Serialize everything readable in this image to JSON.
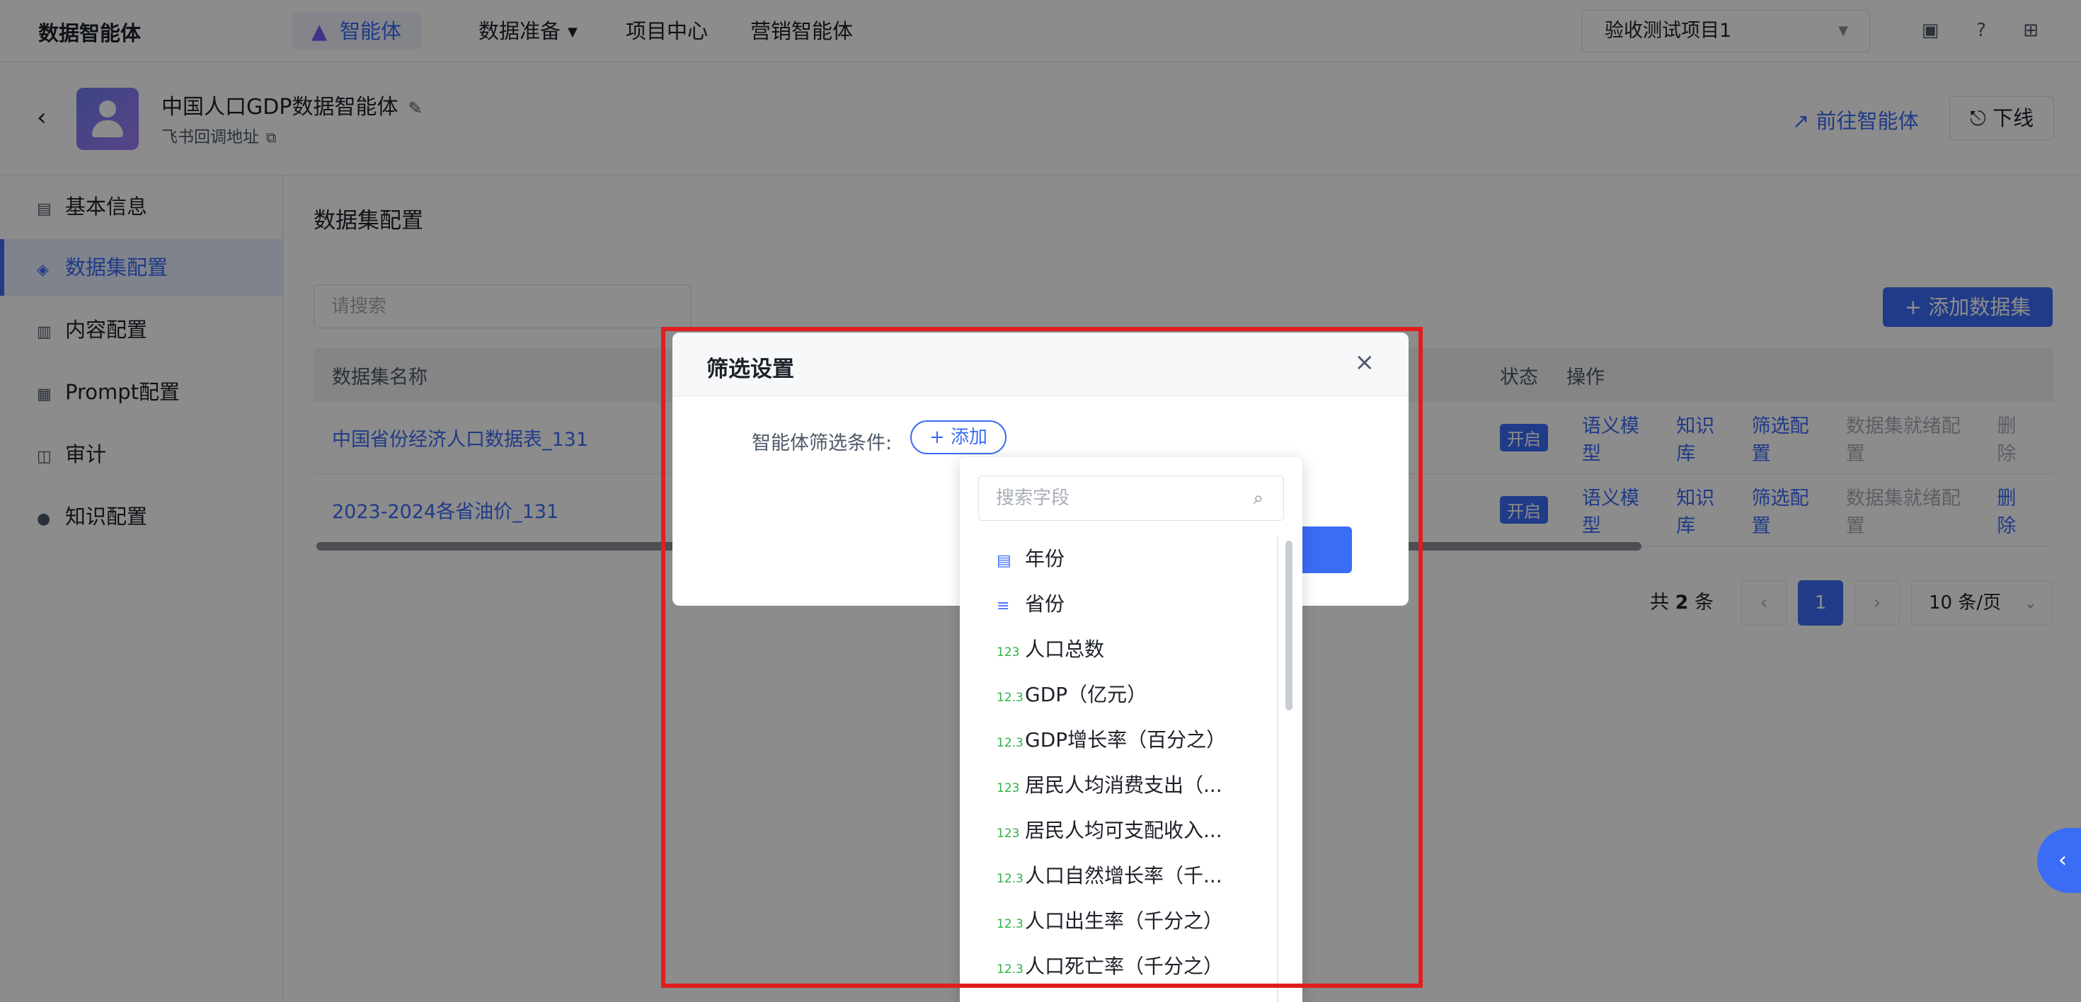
{
  "topbar": {
    "brand": "数据智能体",
    "nav": [
      "智能体",
      "数据准备",
      "项目中心",
      "营销智能体"
    ],
    "project": "验收测试项目1"
  },
  "agent": {
    "name": "中国人口GDP数据智能体",
    "subtitle": "飞书回调地址",
    "goto": "前往智能体",
    "offline": "下线"
  },
  "sidebar": {
    "items": [
      {
        "label": "基本信息",
        "icon": "info-icon"
      },
      {
        "label": "数据集配置",
        "icon": "layers-icon"
      },
      {
        "label": "内容配置",
        "icon": "content-icon"
      },
      {
        "label": "Prompt配置",
        "icon": "prompt-icon"
      },
      {
        "label": "审计",
        "icon": "audit-icon"
      },
      {
        "label": "知识配置",
        "icon": "bulb-icon"
      }
    ]
  },
  "main": {
    "title": "数据集配置",
    "search_placeholder": "请搜索",
    "add_dataset": "添加数据集",
    "columns": {
      "name": "数据集名称",
      "status": "状态",
      "ops": "操作"
    },
    "rows": [
      {
        "name": "中国省份经济人口数据表_131",
        "status": "开启",
        "ops": [
          "语义模型",
          "知识库",
          "筛选配置",
          "数据集就绪配置",
          "删除"
        ]
      },
      {
        "name": "2023-2024各省油价_131",
        "status": "开启",
        "ops": [
          "语义模型",
          "知识库",
          "筛选配置",
          "数据集就绪配置",
          "删除"
        ]
      }
    ],
    "pager": {
      "total_prefix": "共",
      "total": "2",
      "total_suffix": "条",
      "current": "1",
      "page_size": "10 条/页"
    }
  },
  "modal": {
    "title": "筛选设置",
    "condition_label": "智能体筛选条件:",
    "add_button": "+ 添加"
  },
  "dropdown": {
    "search_placeholder": "搜索字段",
    "fields": [
      {
        "type": "date",
        "label": "年份"
      },
      {
        "type": "text",
        "label": "省份"
      },
      {
        "type": "int",
        "label": "人口总数"
      },
      {
        "type": "float",
        "label": "GDP（亿元）"
      },
      {
        "type": "float",
        "label": "GDP增长率（百分之）"
      },
      {
        "type": "int",
        "label": "居民人均消费支出（..."
      },
      {
        "type": "int",
        "label": "居民人均可支配收入..."
      },
      {
        "type": "float",
        "label": "人口自然增长率（千..."
      },
      {
        "type": "float",
        "label": "人口出生率（千分之）"
      },
      {
        "type": "float",
        "label": "人口死亡率（千分之）"
      }
    ]
  }
}
